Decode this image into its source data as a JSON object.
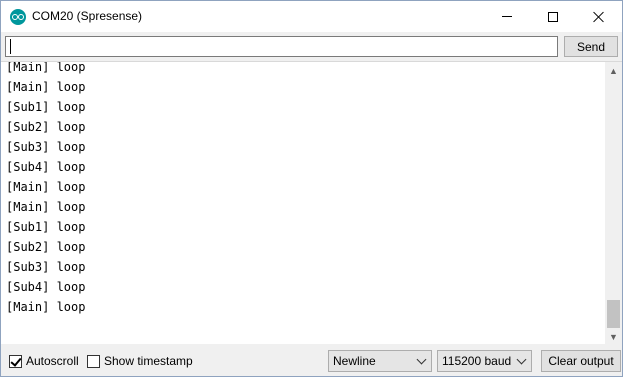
{
  "window": {
    "title": "COM20 (Spresense)",
    "accent_color": "#00979c",
    "icons": {
      "app": "arduino-icon",
      "minimize": "minimize-icon",
      "maximize": "maximize-icon",
      "close": "close-icon"
    }
  },
  "input": {
    "value": "",
    "send_label": "Send"
  },
  "output": {
    "lines": [
      "[Main] loop",
      "[Main] loop",
      "[Sub1] loop",
      "[Sub2] loop",
      "[Sub3] loop",
      "[Sub4] loop",
      "[Main] loop",
      "[Main] loop",
      "[Sub1] loop",
      "[Sub2] loop",
      "[Sub3] loop",
      "[Sub4] loop",
      "[Main] loop"
    ]
  },
  "status": {
    "autoscroll_label": "Autoscroll",
    "autoscroll_checked": true,
    "timestamp_label": "Show timestamp",
    "timestamp_checked": false,
    "line_ending": "Newline",
    "baud_rate": "115200 baud",
    "clear_label": "Clear output"
  }
}
